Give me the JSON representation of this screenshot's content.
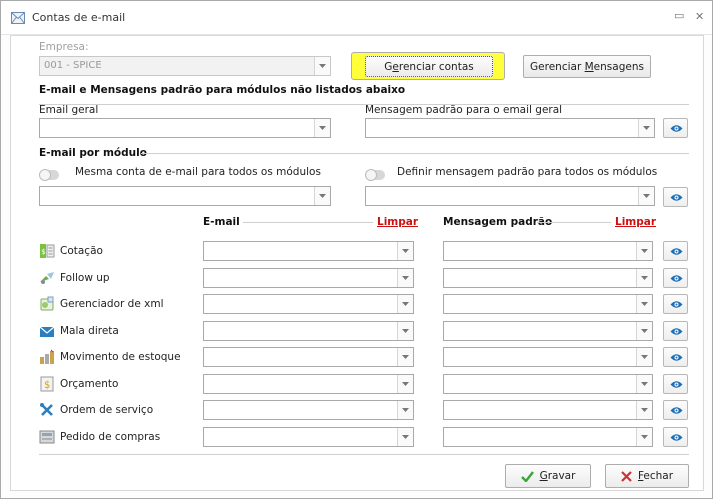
{
  "window": {
    "title": "Contas de e-mail",
    "min_symbol": "▭",
    "close_symbol": "✕"
  },
  "empresa": {
    "label": "Empresa:",
    "value": "001 - SPICE"
  },
  "buttons": {
    "gerenciar_contas": {
      "pre": "G",
      "underline": "e",
      "post": "renciar contas"
    },
    "gerenciar_mensagens": {
      "pre": "Gerenciar ",
      "underline": "M",
      "post": "ensagens"
    },
    "gravar": {
      "underline": "G",
      "post": "ravar"
    },
    "fechar": {
      "underline": "F",
      "post": "echar"
    }
  },
  "padrao_section": {
    "title": "E-mail e Mensagens padrão para módulos não listados abaixo",
    "email_geral_label": "Email geral",
    "mensagem_label": "Mensagem padrão para o email geral"
  },
  "modulo_section": {
    "title": "E-mail por módulo",
    "toggle_email_label": "Mesma conta de e-mail para todos os módulos",
    "toggle_msg_label": "Definir mensagem padrão para todos os módulos"
  },
  "columns": {
    "email": "E-mail",
    "mensagem": "Mensagem padrão",
    "limpar": "Limpar"
  },
  "modules": [
    {
      "label": "Cotação",
      "icon": "cotacao-icon"
    },
    {
      "label": "Follow up",
      "icon": "follow-up-icon"
    },
    {
      "label": "Gerenciador de xml",
      "icon": "xml-icon"
    },
    {
      "label": "Mala direta",
      "icon": "mail-icon"
    },
    {
      "label": "Movimento de estoque",
      "icon": "estoque-icon"
    },
    {
      "label": "Orçamento",
      "icon": "orcamento-icon"
    },
    {
      "label": "Ordem de serviço",
      "icon": "ordem-servico-icon"
    },
    {
      "label": "Pedido de compras",
      "icon": "pedido-compras-icon"
    }
  ],
  "colors": {
    "highlight": "#ffff3a",
    "eye_accent": "#1f6fb5",
    "limpar": "#cc1111",
    "gravar_check": "#3aa63a",
    "fechar_x": "#d23030"
  }
}
